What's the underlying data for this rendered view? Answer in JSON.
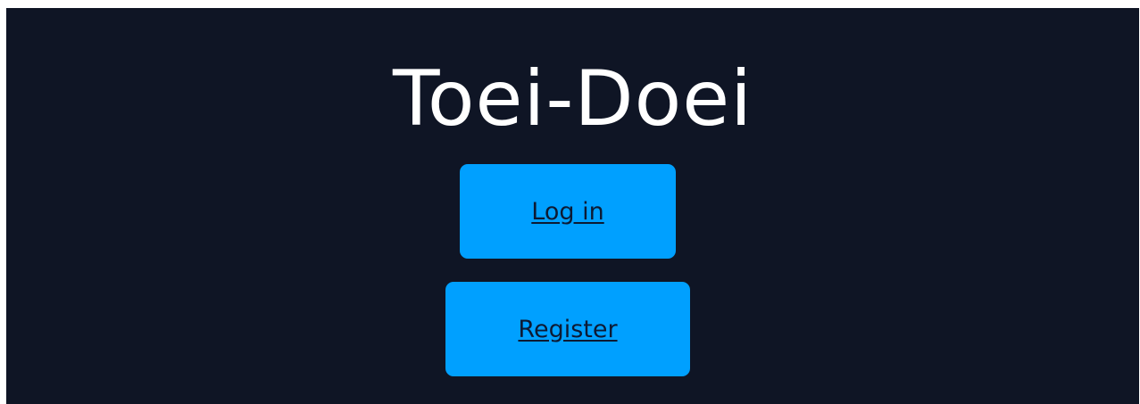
{
  "app": {
    "title": "Toei-Doei"
  },
  "actions": {
    "login_label": "Log in",
    "register_label": "Register"
  },
  "colors": {
    "background": "#0f1525",
    "button": "#00a0ff",
    "button_text": "#0d1a33",
    "title_text": "#ffffff"
  }
}
